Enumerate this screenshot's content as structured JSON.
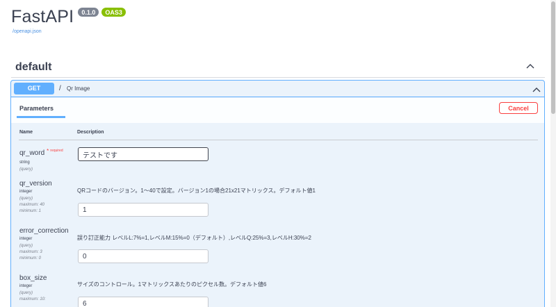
{
  "info": {
    "title": "FastAPI",
    "version_badge": "0.1.0",
    "oas_badge": "OAS3",
    "openapi_link": "/openapi.json"
  },
  "section": {
    "title": "default"
  },
  "operation": {
    "method": "GET",
    "path": "/",
    "summary": "Qr Image"
  },
  "panel": {
    "tab_label": "Parameters",
    "cancel_label": "Cancel",
    "col_name": "Name",
    "col_description": "Description"
  },
  "params": [
    {
      "name": "qr_word",
      "required_star": "*",
      "required_text": "required",
      "type": "string",
      "meta": [
        "(query)"
      ],
      "description": "",
      "value": "テストです"
    },
    {
      "name": "qr_version",
      "type": "integer",
      "meta": [
        "(query)",
        "maximum: 40",
        "minimum: 1"
      ],
      "description": "QRコードのバージョン。1〜40で設定。バージョン1の場合21x21マトリックス。デフォルト値1",
      "value": "1"
    },
    {
      "name": "error_correction",
      "type": "integer",
      "meta": [
        "(query)",
        "maximum: 3",
        "minimum: 0"
      ],
      "description": "誤り訂正能力 レベルL:7%=1,レベルM:15%=0（デフォルト）,レベルQ:25%=3,レベルH:30%=2",
      "value": "0"
    },
    {
      "name": "box_size",
      "type": "integer",
      "meta": [
        "(query)",
        "maximum: 10:"
      ],
      "description": "サイズのコントロール。1マトリックスあたりのピクセル数。デフォルト値6",
      "value": "6"
    }
  ],
  "colors": {
    "get_blue": "#61affe",
    "opblock_bg": "#ebf3fb",
    "cancel_red": "#f93e3e",
    "oas_green": "#89bf04",
    "version_gray": "#7d8492",
    "link_blue": "#4990e2",
    "text": "#3b4151"
  },
  "icons": {
    "section_toggle": "chevron-up-icon",
    "operation_toggle": "chevron-up-icon"
  }
}
